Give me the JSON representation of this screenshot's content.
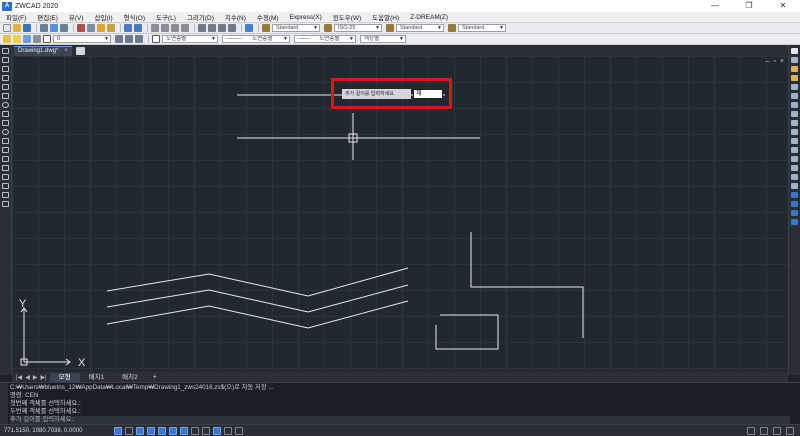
{
  "window": {
    "title": "ZWCAD 2020",
    "logo": "A",
    "controls": [
      "—",
      "❐",
      "✕"
    ]
  },
  "menu": [
    "파일(F)",
    "편집(E)",
    "뷰(V)",
    "삽입(I)",
    "형식(O)",
    "도구(L)",
    "그리기(D)",
    "치수(N)",
    "수정(M)",
    "Express(X)",
    "윈도우(W)",
    "도움말(H)",
    "Z-DREAM(Z)"
  ],
  "toolbar1": {
    "text_style": "Standard",
    "dim_style": "ISO-25",
    "table_style": "Standard",
    "multileader_style": "Standard"
  },
  "toolbar2": {
    "layer": "0",
    "color": "도면층별",
    "linetype": "도면층별",
    "lineweight": "도면층별",
    "plot_style": "색상별"
  },
  "doc_tab": {
    "name": "Drawing1.dwg*",
    "close": "×"
  },
  "dynamic_input": {
    "prompt": "추가 길이를 입력하세요.",
    "value": "채"
  },
  "axes": {
    "x": "X",
    "y": "Y"
  },
  "layout_tabs": [
    "모형",
    "배치1",
    "배치2"
  ],
  "layout_add": "+",
  "command_history": [
    "C:₩Users₩bluetns_12₩AppData₩Local₩Temp₩Drawing1_zws24016.zs$(으)로 자동 저장 ...",
    "명령: CEN",
    "첫번째 객체를 선택하세요.:",
    "두번째 객체를 선택하세요.:"
  ],
  "command_prompt": "추가 길이를 입력하세요.:",
  "status": {
    "coordinates": "771.5150, 1080.7038, 0.0000"
  },
  "colors": {
    "canvas": "#212830",
    "highlight": "#e0141a",
    "accent": "#3b77c9"
  }
}
